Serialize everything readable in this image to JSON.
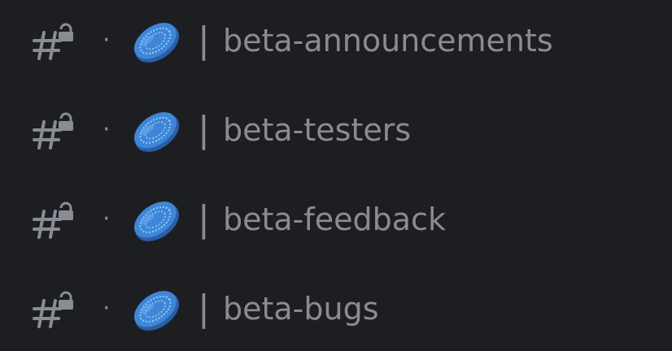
{
  "channels": [
    {
      "dot": "·",
      "separator": "|",
      "name": "beta-announcements",
      "icon": "locked-hash-icon",
      "emoji": "flying-disc-emoji"
    },
    {
      "dot": "·",
      "separator": "|",
      "name": "beta-testers",
      "icon": "locked-hash-icon",
      "emoji": "flying-disc-emoji"
    },
    {
      "dot": "·",
      "separator": "|",
      "name": "beta-feedback",
      "icon": "locked-hash-icon",
      "emoji": "flying-disc-emoji"
    },
    {
      "dot": "·",
      "separator": "|",
      "name": "beta-bugs",
      "icon": "locked-hash-icon",
      "emoji": "flying-disc-emoji"
    }
  ],
  "colors": {
    "background": "#1d1e22",
    "text": "#8a8c94",
    "disc": "#3f86d8",
    "disc_ring": "#8fd0ff"
  }
}
